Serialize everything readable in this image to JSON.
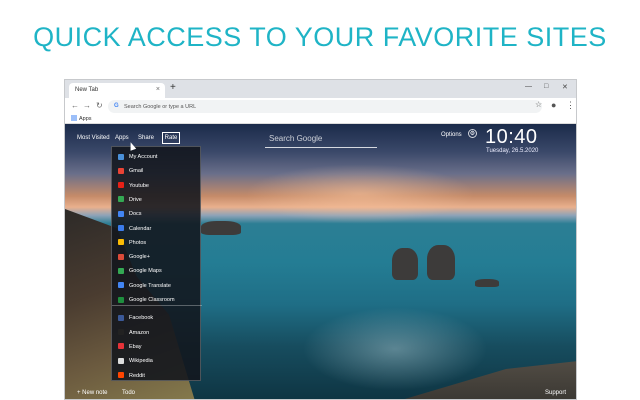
{
  "headline": "QUICK ACCESS TO YOUR FAVORITE SITES",
  "browser": {
    "tab_title": "New Tab",
    "tab_close": "×",
    "new_tab": "+",
    "minimize": "—",
    "maximize": "□",
    "close": "✕",
    "back": "←",
    "forward": "→",
    "reload": "↻",
    "omnibox_g": "G",
    "omnibox_placeholder": "Search Google or type a URL",
    "star": "☆",
    "profile": "●",
    "menu": "⋮",
    "bookmark_apps": "Apps"
  },
  "newtab": {
    "nav": {
      "most_visited": "Most Visited",
      "apps": "Apps",
      "share": "Share",
      "rate": "Rate"
    },
    "search_placeholder": "Search Google",
    "options": "Options",
    "gear": "⚙",
    "time": "10:40",
    "date": "Tuesday, 26.5.2020",
    "apps_menu": [
      {
        "label": "My Account",
        "icon": "account-icon",
        "color": "#4a90d9"
      },
      {
        "label": "Gmail",
        "icon": "gmail-icon",
        "color": "#ea4335"
      },
      {
        "label": "Youtube",
        "icon": "youtube-icon",
        "color": "#e62117"
      },
      {
        "label": "Drive",
        "icon": "drive-icon",
        "color": "#34a853"
      },
      {
        "label": "Docs",
        "icon": "docs-icon",
        "color": "#4285f4"
      },
      {
        "label": "Calendar",
        "icon": "calendar-icon",
        "color": "#3b7bea"
      },
      {
        "label": "Photos",
        "icon": "photos-icon",
        "color": "#fbbc05"
      },
      {
        "label": "Google+",
        "icon": "google-plus-icon",
        "color": "#dd4b39"
      },
      {
        "label": "Google Maps",
        "icon": "maps-icon",
        "color": "#34a853"
      },
      {
        "label": "Google Translate",
        "icon": "translate-icon",
        "color": "#4285f4"
      },
      {
        "label": "Google Classroom",
        "icon": "classroom-icon",
        "color": "#1e8e3e"
      },
      {
        "label": "Facebook",
        "icon": "facebook-icon",
        "color": "#3b5998"
      },
      {
        "label": "Amazon",
        "icon": "amazon-icon",
        "color": "#222222"
      },
      {
        "label": "Ebay",
        "icon": "ebay-icon",
        "color": "#e53238"
      },
      {
        "label": "Wikipedia",
        "icon": "wikipedia-icon",
        "color": "#dddddd"
      },
      {
        "label": "Reddit",
        "icon": "reddit-icon",
        "color": "#ff4500"
      }
    ],
    "bottom": {
      "new_note": "+ New note",
      "todo": "Todo",
      "support": "Support"
    }
  }
}
